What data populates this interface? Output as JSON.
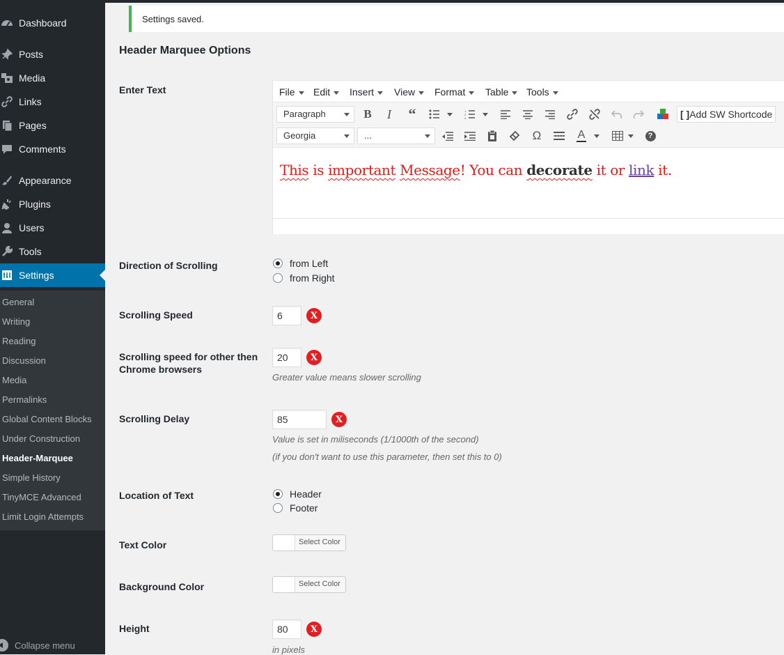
{
  "sidebar": {
    "items": [
      {
        "label": "Dashboard",
        "icon": "dashboard-icon"
      },
      {
        "label": "Posts",
        "icon": "pin-icon"
      },
      {
        "label": "Media",
        "icon": "media-icon"
      },
      {
        "label": "Links",
        "icon": "link-icon"
      },
      {
        "label": "Pages",
        "icon": "pages-icon"
      },
      {
        "label": "Comments",
        "icon": "comment-icon"
      },
      {
        "label": "Appearance",
        "icon": "brush-icon"
      },
      {
        "label": "Plugins",
        "icon": "plugin-icon"
      },
      {
        "label": "Users",
        "icon": "user-icon"
      },
      {
        "label": "Tools",
        "icon": "wrench-icon"
      },
      {
        "label": "Settings",
        "icon": "settings-icon"
      }
    ],
    "submenu": [
      "General",
      "Writing",
      "Reading",
      "Discussion",
      "Media",
      "Permalinks",
      "Global Content Blocks",
      "Under Construction",
      "Header-Marquee",
      "Simple History",
      "TinyMCE Advanced",
      "Limit Login Attempts"
    ],
    "collapse_label": "Collapse menu"
  },
  "notice": {
    "text": "Settings saved."
  },
  "page_title": "Header Marquee Options",
  "labels": {
    "enter_text": "Enter Text",
    "direction": "Direction of Scrolling",
    "speed": "Scrolling Speed",
    "speed_other": "Scrolling speed for other then Chrome browsers",
    "delay": "Scrolling Delay",
    "location": "Location of Text",
    "text_color": "Text Color",
    "bg_color": "Background Color",
    "height": "Height"
  },
  "editor": {
    "menu": [
      "File",
      "Edit",
      "Insert",
      "View",
      "Format",
      "Table",
      "Tools"
    ],
    "format_select": "Paragraph",
    "font_select": "Georgia",
    "size_select": "...",
    "sw_shortcode": "Add SW Shortcode",
    "content": {
      "part1": "This",
      "part2": " is ",
      "part3": "important",
      "part4": " ",
      "part5": "Message",
      "part6": "! You can ",
      "bold": "decorate",
      "part7": " it or ",
      "link": "link",
      "part8": " it."
    },
    "colors": {
      "text": "#e01b1b",
      "link": "#6b3fa0"
    }
  },
  "direction": {
    "options": [
      "from Left",
      "from Right"
    ],
    "selected": "from Left"
  },
  "speed": {
    "value": "6",
    "remove": "X"
  },
  "speed_other": {
    "value": "20",
    "remove": "X",
    "description": "Greater value means slower scrolling"
  },
  "delay": {
    "value": "85",
    "remove": "X",
    "description1": "Value is set in miliseconds (1/1000th of the second)",
    "description2": "(if you don't want to use this parameter, then set this to 0)"
  },
  "location": {
    "options": [
      "Header",
      "Footer"
    ],
    "selected": "Header"
  },
  "text_color": {
    "button": "Select Color"
  },
  "bg_color": {
    "button": "Select Color"
  },
  "height": {
    "value": "80",
    "remove": "X",
    "description": "in pixels"
  }
}
